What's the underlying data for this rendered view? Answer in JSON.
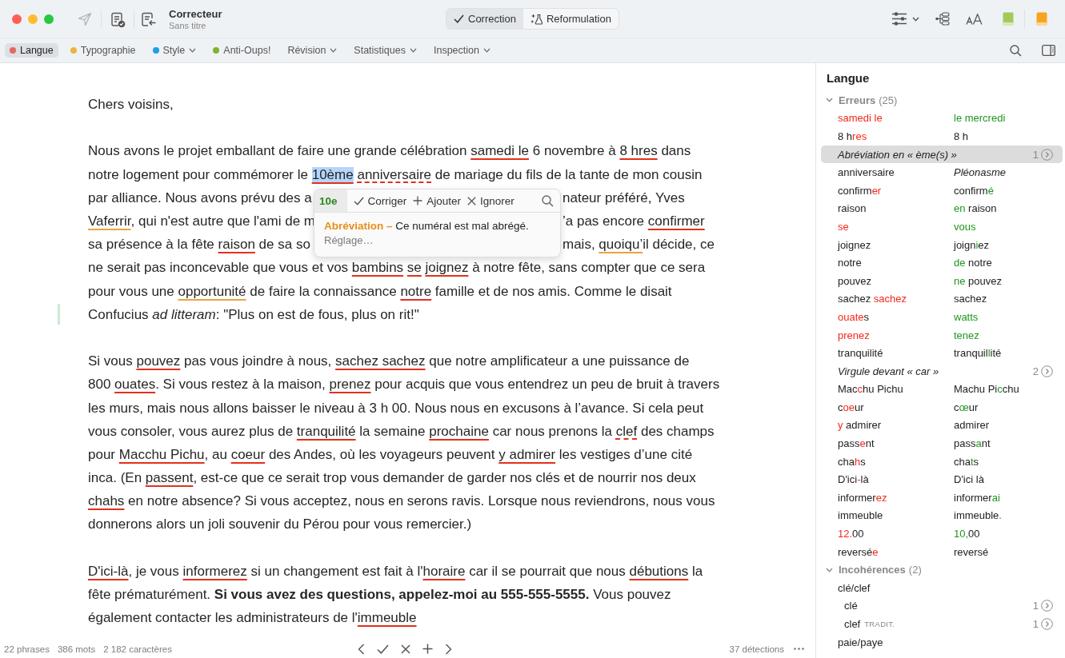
{
  "window": {
    "title": "Correcteur",
    "subtitle": "Sans titre"
  },
  "modes": [
    {
      "label": "Correction",
      "kind": "correction",
      "selected": true
    },
    {
      "label": "Reformulation",
      "kind": "rephrase",
      "selected": false
    }
  ],
  "tabs": [
    {
      "label": "Langue",
      "selected": true,
      "color": "#e26a60",
      "dropdown": false
    },
    {
      "label": "Typographie",
      "selected": false,
      "color": "#e8b63c",
      "dropdown": false
    },
    {
      "label": "Style",
      "selected": false,
      "color": "#1d9fe6",
      "dropdown": true
    },
    {
      "label": "Anti-Oups!",
      "selected": false,
      "color": "#7db52f",
      "dropdown": false
    },
    {
      "label": "Révision",
      "selected": false,
      "dropdown": true
    },
    {
      "label": "Statistiques",
      "selected": false,
      "dropdown": true
    },
    {
      "label": "Inspection",
      "selected": false,
      "dropdown": true
    }
  ],
  "document": {
    "paragraphs": [
      {
        "lines": [
          {
            "mark": false,
            "segments": [
              {
                "text": "Chers voisins,",
                "kind": "plain"
              }
            ]
          }
        ]
      },
      {
        "lines": [
          {
            "mark": false,
            "segments": [
              {
                "text": "Nous avons le projet emballant de faire une grande célébration ",
                "kind": "plain"
              },
              {
                "text": "samedi le",
                "kind": "error"
              },
              {
                "text": " 6 novembre à ",
                "kind": "plain"
              },
              {
                "text": "8 hres",
                "kind": "error"
              },
              {
                "text": " dans",
                "kind": "plain"
              }
            ]
          },
          {
            "mark": false,
            "segments": [
              {
                "text": "notre logement pour commémorer le ",
                "kind": "plain"
              },
              {
                "text": "10ème",
                "kind": "selected"
              },
              {
                "text": " anniversaire",
                "kind": "dashed"
              },
              {
                "text": " de mariage du fils de la tante de mon cousin",
                "kind": "plain"
              }
            ]
          },
          {
            "mark": false,
            "segments": [
              {
                "text": "par alliance. Nous avons prévu des a",
                "kind": "plain"
              }
            ],
            "after": [
              {
                "text": "nateur préféré, Yves",
                "kind": "plain"
              }
            ]
          },
          {
            "mark": false,
            "segments": [
              {
                "text": "Vaferrir",
                "kind": "warning"
              },
              {
                "text": ", qui n'est autre que l'ami de m",
                "kind": "plain"
              }
            ],
            "after": [
              {
                "text": "’a pas encore ",
                "kind": "plain"
              },
              {
                "text": "confirmer",
                "kind": "error"
              }
            ]
          },
          {
            "mark": false,
            "segments": [
              {
                "text": "sa présence à la fête ",
                "kind": "plain"
              },
              {
                "text": "raison",
                "kind": "error"
              },
              {
                "text": " de sa so",
                "kind": "plain"
              }
            ],
            "after": [
              {
                "text": "mais, ",
                "kind": "plain"
              },
              {
                "text": "quoiqu’",
                "kind": "warning"
              },
              {
                "text": "il décide, ce",
                "kind": "plain"
              }
            ]
          },
          {
            "mark": false,
            "segments": [
              {
                "text": "ne serait pas inconcevable que vous et vos ",
                "kind": "plain"
              },
              {
                "text": "bambins",
                "kind": "error"
              },
              {
                "text": " se",
                "kind": "error"
              },
              {
                "text": " joignez",
                "kind": "error"
              },
              {
                "text": " à notre fête, sans compter que ce sera",
                "kind": "plain"
              }
            ]
          },
          {
            "mark": false,
            "segments": [
              {
                "text": "pour vous une ",
                "kind": "plain"
              },
              {
                "text": "opportunité",
                "kind": "warning"
              },
              {
                "text": " de faire la connaissance ",
                "kind": "plain"
              },
              {
                "text": "notre",
                "kind": "error"
              },
              {
                "text": " famille et de nos amis. Comme le disait",
                "kind": "plain"
              }
            ]
          },
          {
            "mark": true,
            "segments": [
              {
                "text": "Confucius *ad litteram*: \"Plus on est de fous, plus on rit!\"",
                "kind": "plain"
              }
            ]
          }
        ]
      },
      {
        "lines": [
          {
            "mark": false,
            "segments": [
              {
                "text": "Si vous ",
                "kind": "plain"
              },
              {
                "text": "pouvez",
                "kind": "error"
              },
              {
                "text": " pas vous joindre à nous, ",
                "kind": "plain"
              },
              {
                "text": "sachez sachez",
                "kind": "error"
              },
              {
                "text": " que notre amplificateur a une puissance de",
                "kind": "plain"
              }
            ]
          },
          {
            "mark": false,
            "segments": [
              {
                "text": "800 ",
                "kind": "plain"
              },
              {
                "text": "ouates",
                "kind": "error"
              },
              {
                "text": ". Si vous restez à la maison, ",
                "kind": "plain"
              },
              {
                "text": "prenez",
                "kind": "error"
              },
              {
                "text": " pour acquis que vous entendrez un peu de bruit à travers",
                "kind": "plain"
              }
            ]
          },
          {
            "mark": false,
            "segments": [
              {
                "text": "les murs, mais nous allons baisser le niveau à 3 h 00. Nous nous en excusons à l’avance. Si cela peut",
                "kind": "plain"
              }
            ]
          },
          {
            "mark": false,
            "segments": [
              {
                "text": "vous consoler, vous aurez plus de ",
                "kind": "plain"
              },
              {
                "text": "tranquilité",
                "kind": "error"
              },
              {
                "text": " la semaine ",
                "kind": "plain"
              },
              {
                "text": "prochaine",
                "kind": "error"
              },
              {
                "text": " car nous prenons la ",
                "kind": "plain"
              },
              {
                "text": "clef",
                "kind": "dashed"
              },
              {
                "text": " des champs",
                "kind": "plain"
              }
            ]
          },
          {
            "mark": false,
            "segments": [
              {
                "text": "pour ",
                "kind": "plain"
              },
              {
                "text": "Macchu Pichu",
                "kind": "error"
              },
              {
                "text": ", au ",
                "kind": "plain"
              },
              {
                "text": "coeur",
                "kind": "error"
              },
              {
                "text": " des Andes, où les voyageurs peuvent ",
                "kind": "plain"
              },
              {
                "text": "y admirer",
                "kind": "error"
              },
              {
                "text": " les vestiges d’une cité",
                "kind": "plain"
              }
            ]
          },
          {
            "mark": false,
            "segments": [
              {
                "text": "inca. (En ",
                "kind": "plain"
              },
              {
                "text": "passent",
                "kind": "error"
              },
              {
                "text": ", est-ce que ce serait trop vous demander de garder nos clés et de nourrir nos deux",
                "kind": "plain"
              }
            ]
          },
          {
            "mark": false,
            "segments": [
              {
                "text": "chahs",
                "kind": "error"
              },
              {
                "text": " en notre absence? Si vous acceptez, nous en serons ravis. Lorsque nous reviendrons, nous vous",
                "kind": "plain"
              }
            ]
          },
          {
            "mark": false,
            "segments": [
              {
                "text": "donnerons alors un joli souvenir du Pérou pour vous remercier.)",
                "kind": "plain"
              }
            ]
          }
        ]
      },
      {
        "lines": [
          {
            "mark": false,
            "segments": [
              {
                "text": "D'ici-là",
                "kind": "error"
              },
              {
                "text": ", je vous ",
                "kind": "plain"
              },
              {
                "text": "informerez",
                "kind": "error"
              },
              {
                "text": " si un changement est fait à l'",
                "kind": "plain"
              },
              {
                "text": "horaire",
                "kind": "error"
              },
              {
                "text": " car il se pourrait que nous ",
                "kind": "plain"
              },
              {
                "text": "débutions",
                "kind": "error"
              },
              {
                "text": " la",
                "kind": "plain"
              }
            ]
          },
          {
            "mark": false,
            "segments": [
              {
                "text": "fête prématurément. **Si vous avez des questions, appelez-moi au 555-555-5555.** Vous pouvez",
                "kind": "plain"
              }
            ]
          },
          {
            "mark": false,
            "segments": [
              {
                "text": "également contacter les administrateurs de l'",
                "kind": "plain"
              },
              {
                "text": "immeuble",
                "kind": "error"
              }
            ]
          }
        ]
      }
    ]
  },
  "popup": {
    "suggestion": "10e",
    "actions": [
      {
        "label": "Corriger",
        "kind": "accept"
      },
      {
        "label": "Ajouter",
        "kind": "add"
      },
      {
        "label": "Ignorer",
        "kind": "ignore"
      }
    ],
    "message": "**Abréviation –** Ce numéral est mal abrégé.",
    "link": "Réglage…"
  },
  "status_bar": {
    "stats": [
      "22 phrases",
      "386 mots",
      "2 182 caractères"
    ],
    "detections": "37 détections"
  },
  "sidebar": {
    "title": "Langue",
    "sections": [
      {
        "label": "Erreurs",
        "count": "(25)",
        "expanded": true,
        "items": [
          {
            "kind": "pair",
            "selected": false,
            "original": [
              {
                "text": "samedi le",
                "changed": true
              }
            ],
            "correction": [
              {
                "text": "le mercredi",
                "changed": true
              }
            ]
          },
          {
            "kind": "pair",
            "selected": false,
            "original": [
              {
                "text": "8 h",
                "changed": false
              },
              {
                "text": "res",
                "changed": true
              }
            ],
            "correction": [
              {
                "text": "8 h",
                "changed": false
              }
            ]
          },
          {
            "kind": "rule",
            "selected": true,
            "label": "Abréviation en « ème(s) »",
            "count": "1"
          },
          {
            "kind": "note",
            "selected": false,
            "original": [
              {
                "text": "anniversaire",
                "changed": false
              }
            ],
            "note": "Pléonasme"
          },
          {
            "kind": "pair",
            "selected": false,
            "original": [
              {
                "text": "confirm",
                "changed": false
              },
              {
                "text": "er",
                "changed": true
              }
            ],
            "correction": [
              {
                "text": "confirm",
                "changed": false
              },
              {
                "text": "é",
                "changed": true
              }
            ]
          },
          {
            "kind": "pair",
            "selected": false,
            "original": [
              {
                "text": "raison",
                "changed": false
              }
            ],
            "correction": [
              {
                "text": "en",
                "changed": true
              },
              {
                "text": " raison",
                "changed": false
              }
            ]
          },
          {
            "kind": "pair",
            "selected": false,
            "original": [
              {
                "text": "se",
                "changed": true
              }
            ],
            "correction": [
              {
                "text": "vous",
                "changed": true
              }
            ]
          },
          {
            "kind": "pair",
            "selected": false,
            "original": [
              {
                "text": "joignez",
                "changed": false
              }
            ],
            "correction": [
              {
                "text": "joign",
                "changed": false
              },
              {
                "text": "i",
                "changed": true
              },
              {
                "text": "ez",
                "changed": false
              }
            ]
          },
          {
            "kind": "pair",
            "selected": false,
            "original": [
              {
                "text": "notre",
                "changed": false
              }
            ],
            "correction": [
              {
                "text": "de",
                "changed": true
              },
              {
                "text": " notre",
                "changed": false
              }
            ]
          },
          {
            "kind": "pair",
            "selected": false,
            "original": [
              {
                "text": "pouvez",
                "changed": false
              }
            ],
            "correction": [
              {
                "text": "ne",
                "changed": true
              },
              {
                "text": " pouvez",
                "changed": false
              }
            ]
          },
          {
            "kind": "pair",
            "selected": false,
            "original": [
              {
                "text": "sachez ",
                "changed": false
              },
              {
                "text": "sachez",
                "changed": true
              }
            ],
            "correction": [
              {
                "text": "sachez",
                "changed": false
              }
            ]
          },
          {
            "kind": "pair",
            "selected": false,
            "original": [
              {
                "text": "ouate",
                "changed": true
              },
              {
                "text": "s",
                "changed": false
              }
            ],
            "correction": [
              {
                "text": "watts",
                "changed": true
              }
            ]
          },
          {
            "kind": "pair",
            "selected": false,
            "original": [
              {
                "text": "prenez",
                "changed": true
              }
            ],
            "correction": [
              {
                "text": "tenez",
                "changed": true
              }
            ]
          },
          {
            "kind": "pair",
            "selected": false,
            "original": [
              {
                "text": "tranquilité",
                "changed": false
              }
            ],
            "correction": [
              {
                "text": "tranquil",
                "changed": false
              },
              {
                "text": "l",
                "changed": true
              },
              {
                "text": "ité",
                "changed": false
              }
            ]
          },
          {
            "kind": "rule",
            "selected": false,
            "label": "Virgule devant « car »",
            "count": "2"
          },
          {
            "kind": "pair",
            "selected": false,
            "original": [
              {
                "text": "Mac",
                "changed": false
              },
              {
                "text": "c",
                "changed": true
              },
              {
                "text": "hu Pichu",
                "changed": false
              }
            ],
            "correction": [
              {
                "text": "Machu Pi",
                "changed": false
              },
              {
                "text": "c",
                "changed": true
              },
              {
                "text": "chu",
                "changed": false
              }
            ]
          },
          {
            "kind": "pair",
            "selected": false,
            "original": [
              {
                "text": "c",
                "changed": false
              },
              {
                "text": "oe",
                "changed": true
              },
              {
                "text": "ur",
                "changed": false
              }
            ],
            "correction": [
              {
                "text": "c",
                "changed": false
              },
              {
                "text": "œ",
                "changed": true
              },
              {
                "text": "ur",
                "changed": false
              }
            ]
          },
          {
            "kind": "pair",
            "selected": false,
            "original": [
              {
                "text": "y",
                "changed": true
              },
              {
                "text": " admirer",
                "changed": false
              }
            ],
            "correction": [
              {
                "text": "admirer",
                "changed": false
              }
            ]
          },
          {
            "kind": "pair",
            "selected": false,
            "original": [
              {
                "text": "pass",
                "changed": false
              },
              {
                "text": "e",
                "changed": true
              },
              {
                "text": "nt",
                "changed": false
              }
            ],
            "correction": [
              {
                "text": "pass",
                "changed": false
              },
              {
                "text": "a",
                "changed": true
              },
              {
                "text": "nt",
                "changed": false
              }
            ]
          },
          {
            "kind": "pair",
            "selected": false,
            "original": [
              {
                "text": "cha",
                "changed": false
              },
              {
                "text": "h",
                "changed": true
              },
              {
                "text": "s",
                "changed": false
              }
            ],
            "correction": [
              {
                "text": "cha",
                "changed": false
              },
              {
                "text": "t",
                "changed": true
              },
              {
                "text": "s",
                "changed": false
              }
            ]
          },
          {
            "kind": "pair",
            "selected": false,
            "original": [
              {
                "text": "D'ici",
                "changed": false
              },
              {
                "text": "-",
                "changed": true
              },
              {
                "text": "là",
                "changed": false
              }
            ],
            "correction": [
              {
                "text": "D'ici là",
                "changed": false
              }
            ]
          },
          {
            "kind": "pair",
            "selected": false,
            "original": [
              {
                "text": "informer",
                "changed": false
              },
              {
                "text": "ez",
                "changed": true
              }
            ],
            "correction": [
              {
                "text": "informer",
                "changed": false
              },
              {
                "text": "ai",
                "changed": true
              }
            ]
          },
          {
            "kind": "pair",
            "selected": false,
            "original": [
              {
                "text": "immeuble",
                "changed": false
              }
            ],
            "correction": [
              {
                "text": "immeuble",
                "changed": false
              },
              {
                "text": ".",
                "changed": true
              }
            ]
          },
          {
            "kind": "pair",
            "selected": false,
            "original": [
              {
                "text": "12.",
                "changed": true
              },
              {
                "text": "00",
                "changed": false
              }
            ],
            "correction": [
              {
                "text": "10,",
                "changed": true
              },
              {
                "text": "00",
                "changed": false
              }
            ]
          },
          {
            "kind": "pair",
            "selected": false,
            "original": [
              {
                "text": "reversé",
                "changed": false
              },
              {
                "text": "e",
                "changed": true
              }
            ],
            "correction": [
              {
                "text": "reversé",
                "changed": false
              }
            ]
          }
        ]
      },
      {
        "label": "Incohérences",
        "count": "(2)",
        "expanded": true,
        "items": [
          {
            "kind": "group",
            "selected": false,
            "label": "clé/clef",
            "children": [
              {
                "label": "clé",
                "count": "1",
                "selected": false
              },
              {
                "label": "clef",
                "tag": "TRADIT.",
                "count": "1",
                "selected": false
              }
            ]
          },
          {
            "kind": "group",
            "selected": false,
            "label": "paie/paye"
          }
        ]
      }
    ]
  }
}
